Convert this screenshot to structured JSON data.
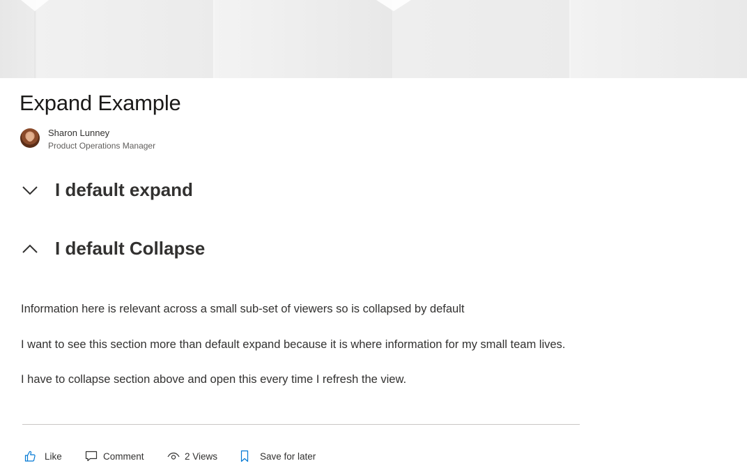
{
  "article": {
    "title": "Expand Example"
  },
  "author": {
    "name": "Sharon Lunney",
    "role": "Product Operations Manager"
  },
  "sections": [
    {
      "title": "I default expand",
      "chevron": "chevron-down-icon"
    },
    {
      "title": "I default Collapse",
      "chevron": "chevron-up-icon"
    }
  ],
  "body": {
    "paragraphs": [
      "Information here is relevant across a small sub-set of viewers so is collapsed by default",
      "I want to see this section more than default expand because it is where information for my small team lives.",
      "I have to collapse section above and open this every time I refresh the view."
    ]
  },
  "actions": {
    "like": {
      "label": "Like",
      "icon": "thumbs-up-icon"
    },
    "comment": {
      "label": "Comment",
      "icon": "comment-icon"
    },
    "views": {
      "label": "2 Views",
      "icon": "eye-icon"
    },
    "save": {
      "label": "Save for later",
      "icon": "bookmark-icon"
    }
  },
  "colors": {
    "accent": "#0078d4",
    "text": "#323130",
    "banner": "#efefef"
  }
}
